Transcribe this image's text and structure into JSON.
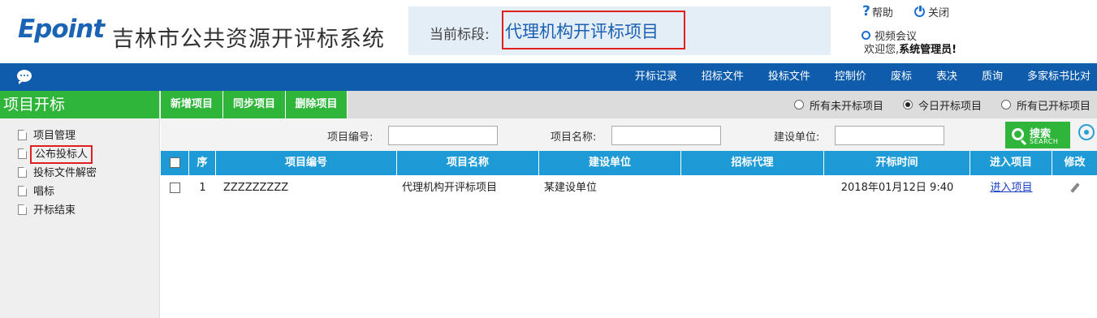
{
  "header": {
    "logo_text": "Epoint",
    "system_title": "吉林市公共资源开评标系统",
    "stage_label": "当前标段:",
    "stage_value": "代理机构开评标项目",
    "help_label": "帮助",
    "close_label": "关闭",
    "video_label": "视频会议",
    "welcome_prefix": "欢迎您,",
    "welcome_user": "系统管理员!"
  },
  "nav": {
    "items": [
      "开标记录",
      "招标文件",
      "投标文件",
      "控制价",
      "废标",
      "表决",
      "质询",
      "多家标书比对"
    ]
  },
  "sidebar": {
    "title": "项目开标",
    "items": [
      {
        "label": "项目管理"
      },
      {
        "label": "公布投标人"
      },
      {
        "label": "投标文件解密"
      },
      {
        "label": "唱标"
      },
      {
        "label": "开标结束"
      }
    ]
  },
  "toolbar": {
    "buttons": [
      "新增项目",
      "同步项目",
      "删除项目"
    ],
    "radios": [
      {
        "label": "所有未开标项目",
        "checked": false
      },
      {
        "label": "今日开标项目",
        "checked": true
      },
      {
        "label": "所有已开标项目",
        "checked": false
      }
    ]
  },
  "search": {
    "project_no_label": "项目编号:",
    "project_name_label": "项目名称:",
    "builder_label": "建设单位:",
    "project_no_value": "",
    "project_name_value": "",
    "builder_value": "",
    "button_text": "搜索",
    "button_subtext": "SEARCH"
  },
  "table": {
    "columns": [
      "序",
      "项目编号",
      "项目名称",
      "建设单位",
      "招标代理",
      "开标时间",
      "进入项目",
      "修改"
    ],
    "rows": [
      {
        "index": "1",
        "project_no": "ZZZZZZZZZ",
        "project_name": "代理机构开评标项目",
        "builder": "某建设单位",
        "agent": "",
        "open_time": "2018年01月12日 9:40",
        "enter": "进入项目"
      }
    ]
  },
  "colors": {
    "nav_blue": "#0f5cad",
    "green": "#2fb53a",
    "table_header": "#1e9bd7",
    "highlight_red": "#e02020"
  }
}
